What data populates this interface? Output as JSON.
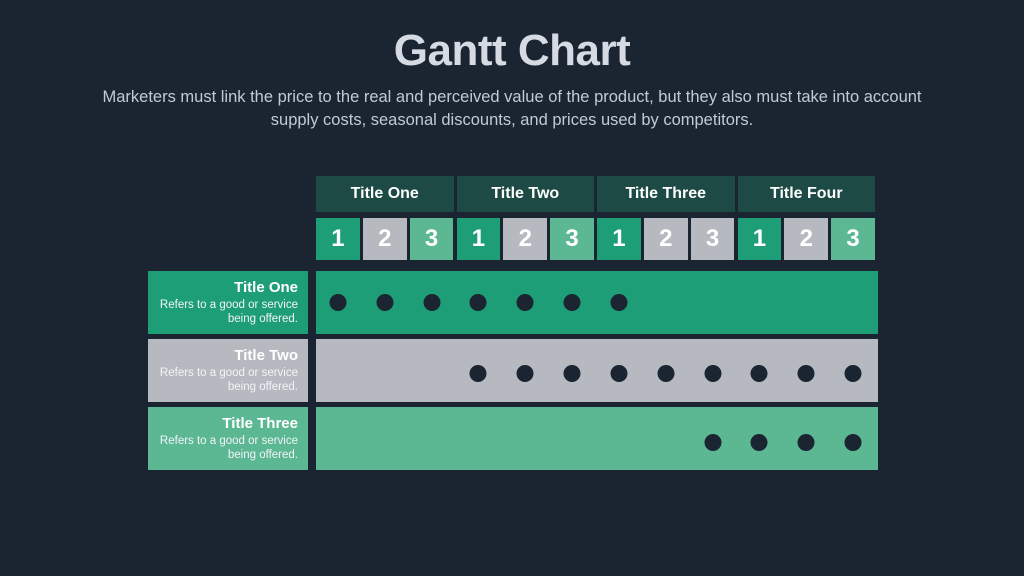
{
  "slide": {
    "title": "Gantt Chart",
    "subtitle": "Marketers must link the price to the real and perceived value of the product, but they also must take into account supply costs, seasonal discounts, and prices used by competitors.",
    "background_color": "#1b2431"
  },
  "palette": {
    "teal_dark": "#1d4a45",
    "green": "#1e9e77",
    "green_light": "#5cb793",
    "gray": "#b6b9c0",
    "dot": "#1b2431",
    "text_light": "#ffffff",
    "title_color": "#d6dbe3",
    "subtitle_color": "#c3cad4"
  },
  "chart_data": {
    "type": "bar",
    "title": "Gantt Chart",
    "xlabel": "",
    "ylabel": "",
    "groups": [
      {
        "label": "Title One",
        "units": [
          "1",
          "2",
          "3"
        ]
      },
      {
        "label": "Title Two",
        "units": [
          "1",
          "2",
          "3"
        ]
      },
      {
        "label": "Title Three",
        "units": [
          "1",
          "2",
          "3"
        ]
      },
      {
        "label": "Title Four",
        "units": [
          "1",
          "2",
          "3"
        ]
      }
    ],
    "unit_colors": [
      "#1e9e77",
      "#b6b9c0",
      "#5cb793",
      "#1e9e77",
      "#b6b9c0",
      "#5cb793",
      "#1e9e77",
      "#b6b9c0",
      "#b6b9c0",
      "#1e9e77",
      "#b6b9c0",
      "#5cb793"
    ],
    "columns": 12,
    "tasks": [
      {
        "label": "Title One",
        "description": "Refers to a good or service being offered.",
        "bar_color": "#1e9e77",
        "dot_columns": [
          1,
          2,
          3,
          4,
          5,
          6,
          7
        ],
        "dot_count": 7,
        "dot_valign": "top"
      },
      {
        "label": "Title Two",
        "description": "Refers to a good or service being offered.",
        "bar_color": "#b6b9c0",
        "dot_columns": [
          4,
          5,
          6,
          7,
          8,
          9,
          10,
          11,
          12
        ],
        "dot_count": 9,
        "dot_valign": "middle"
      },
      {
        "label": "Title Three",
        "description": "Refers to a good or service being offered.",
        "bar_color": "#5cb793",
        "dot_columns": [
          9,
          10,
          11,
          12
        ],
        "dot_count": 4,
        "dot_valign": "bottom"
      }
    ]
  }
}
